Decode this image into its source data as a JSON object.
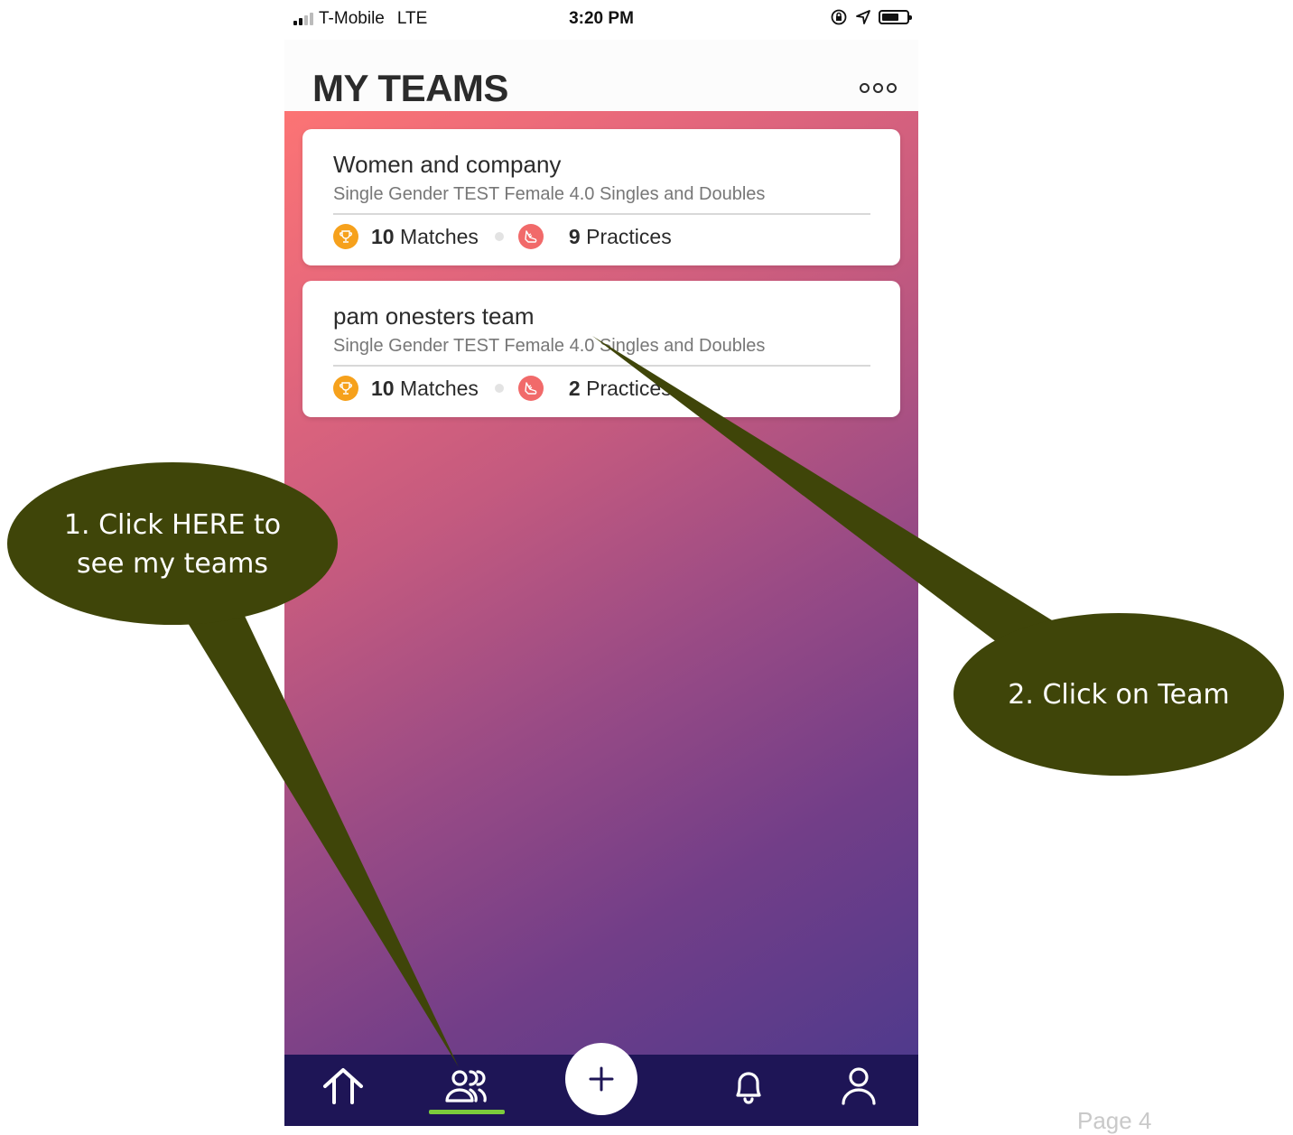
{
  "status_bar": {
    "carrier": "T-Mobile",
    "network": "LTE",
    "time": "3:20 PM"
  },
  "header": {
    "title": "MY TEAMS"
  },
  "teams": [
    {
      "name": "Women and company",
      "subtitle": "Single Gender TEST Female 4.0 Singles and Doubles",
      "matches_count": "10",
      "matches_label": "Matches",
      "practices_count": "9",
      "practices_label": "Practices"
    },
    {
      "name": "pam onesters team",
      "subtitle": "Single Gender TEST Female 4.0 Singles and Doubles",
      "matches_count": "10",
      "matches_label": "Matches",
      "practices_count": "2",
      "practices_label": "Practices"
    }
  ],
  "tab_bar": {
    "items": [
      "home-icon",
      "teams-icon",
      "add-icon",
      "bell-icon",
      "profile-icon"
    ],
    "active": "teams-icon",
    "active_color": "#7ccb3c"
  },
  "callouts": {
    "one_line1": "1. Click HERE to",
    "one_line2": "see my teams",
    "two": "2. Click on Team",
    "color": "#3f4509"
  },
  "page_label": "Page 4",
  "colors": {
    "gradient_start": "#fc7474",
    "gradient_end": "#503a8c",
    "tab_bar_bg": "#1e1556",
    "trophy": "#f6a11c",
    "practice": "#f16a6a"
  }
}
